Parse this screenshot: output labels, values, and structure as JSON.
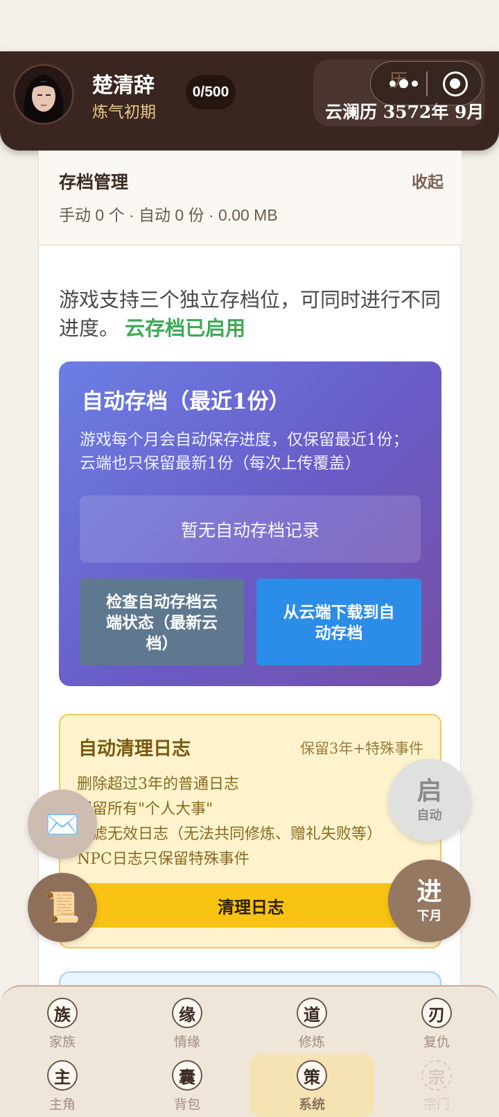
{
  "header": {
    "name": "楚清辞",
    "realm": "炼气初期",
    "progress": "0/500",
    "calendar_top": "历",
    "calendar": "云澜历 3572年 9月"
  },
  "capsule": {
    "more_icon": "more-dots-icon",
    "close_icon": "target-icon"
  },
  "panel": {
    "title": "存档管理",
    "collapse": "收起",
    "stats": "手动 0 个 · 自动 0 份 · 0.00 MB",
    "intro": "游戏支持三个独立存档位，可同时进行不同进度。",
    "cloud_status": "云存档已启用"
  },
  "auto_save": {
    "title": "自动存档（最近1份）",
    "desc": "游戏每个月会自动保存进度，仅保留最近1份；云端也只保留最新1份（每次上传覆盖）",
    "empty": "暂无自动存档记录",
    "check_btn": "检查自动存档云端状态（最新云档）",
    "download_btn": "从云端下载到自动存档"
  },
  "log_clean": {
    "title": "自动清理日志",
    "subtitle": "保留3年+特殊事件",
    "lines": [
      "删除超过3年的普通日志",
      "保留所有\"个人大事\"",
      "过滤无效日志（无法共同修炼、赠礼失败等）",
      "NPC日志只保留特殊事件"
    ],
    "button": "清理日志"
  },
  "fabs": {
    "mail_icon": "✉️",
    "scroll_icon": "📜",
    "auto_big": "启",
    "auto_small": "自动",
    "next_big": "进",
    "next_small": "下月"
  },
  "nav": [
    {
      "icon": "族",
      "label": "家族",
      "state": "normal"
    },
    {
      "icon": "缘",
      "label": "情缘",
      "state": "normal"
    },
    {
      "icon": "道",
      "label": "修炼",
      "state": "normal"
    },
    {
      "icon": "刃",
      "label": "复仇",
      "state": "normal"
    },
    {
      "icon": "主",
      "label": "主角",
      "state": "normal"
    },
    {
      "icon": "囊",
      "label": "背包",
      "state": "normal"
    },
    {
      "icon": "策",
      "label": "系统",
      "state": "active"
    },
    {
      "icon": "宗",
      "label": "宗门",
      "state": "disabled"
    }
  ]
}
